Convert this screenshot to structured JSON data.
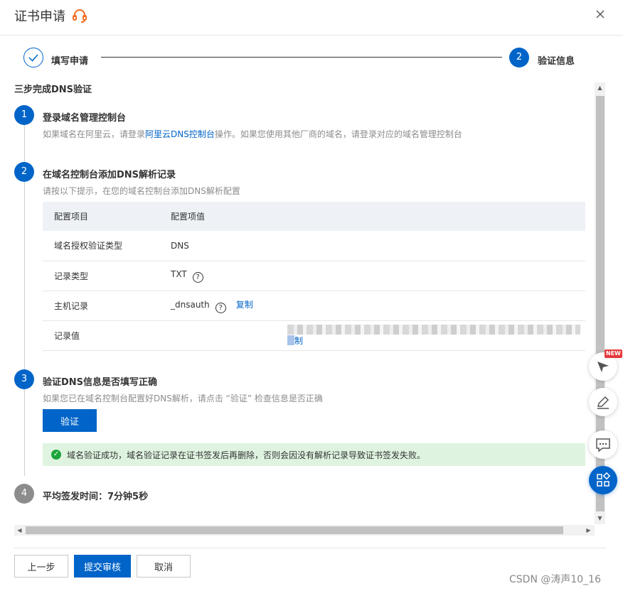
{
  "header": {
    "title": "证书申请",
    "headset_icon": "headset-icon",
    "close_icon": "close-icon"
  },
  "steps": {
    "step1_label": "填写申请",
    "step2_number": "2",
    "step2_label": "验证信息"
  },
  "section_title": "三步完成DNS验证",
  "step1": {
    "number": "1",
    "title": "登录域名管理控制台",
    "desc_prefix": "如果域名在阿里云，请登录",
    "desc_link": "阿里云DNS控制台",
    "desc_suffix": "操作。如果您使用其他厂商的域名，请登录对应的域名管理控制台"
  },
  "step2": {
    "number": "2",
    "title": "在域名控制台添加DNS解析记录",
    "desc": "请按以下提示，在您的域名控制台添加DNS解析配置",
    "table": {
      "headers": [
        "配置项目",
        "配置项值"
      ],
      "rows": [
        {
          "label": "域名授权验证类型",
          "value": "DNS"
        },
        {
          "label": "记录类型",
          "value": "TXT"
        },
        {
          "label": "主机记录",
          "value": "_dnsauth",
          "copy": "复制"
        },
        {
          "label": "记录值",
          "value_redacted": true,
          "copy_partial": "制"
        }
      ]
    }
  },
  "step3": {
    "number": "3",
    "title": "验证DNS信息是否填写正确",
    "desc": "如果您已在域名控制台配置好DNS解析，请点击 “验证” 检查信息是否正确",
    "verify_button": "验证",
    "success_message": "域名验证成功，域名验证记录在证书签发后再删除，否则会因没有解析记录导致证书签发失败。"
  },
  "step4": {
    "number": "4",
    "title": "平均签发时间：7分钟5秒"
  },
  "footer": {
    "prev": "上一步",
    "submit": "提交审核",
    "cancel": "取消"
  },
  "floating": {
    "new_badge": "NEW"
  },
  "watermark": "CSDN @涛声10_16",
  "colors": {
    "primary": "#0064c8",
    "success_bg": "#dff4e0",
    "success_icon": "#1ea53c"
  }
}
